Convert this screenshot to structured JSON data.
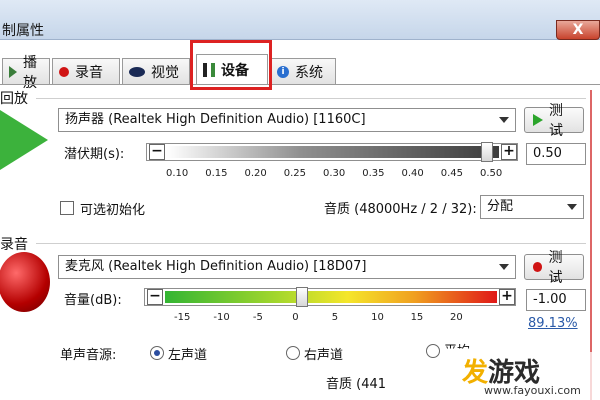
{
  "window": {
    "title": "制属性",
    "close_glyph": "X"
  },
  "tabs": [
    {
      "label": "播放",
      "icon": "speaker-icon"
    },
    {
      "label": "录音",
      "icon": "record-dot-icon"
    },
    {
      "label": "视觉",
      "icon": "eye-icon"
    },
    {
      "label": "设备",
      "icon": "device-icon",
      "active": true
    },
    {
      "label": "系统",
      "icon": "info-icon"
    }
  ],
  "playback": {
    "section_label": "回放",
    "device": "扬声器 (Realtek High Definition Audio) [1160C]",
    "test_button": "测试",
    "latency_label": "潜伏期(s):",
    "latency_ticks": [
      "0.10",
      "0.15",
      "0.20",
      "0.25",
      "0.30",
      "0.35",
      "0.40",
      "0.45",
      "0.50"
    ],
    "latency_value": "0.50",
    "latency_fraction": 0.98,
    "optional_init_label": "可选初始化",
    "quality_label": "音质 (48000Hz / 2 / 32):",
    "quality_select": "分配"
  },
  "recording": {
    "section_label": "录音",
    "device": "麦克风 (Realtek High Definition Audio) [18D07]",
    "test_button": "测试",
    "volume_label": "音量(dB):",
    "volume_ticks": [
      "-15",
      "-10",
      "-5",
      "0",
      "5",
      "10",
      "15",
      "20"
    ],
    "volume_value": "-1.00",
    "volume_percent": "89.13%",
    "volume_fraction": 0.41,
    "mono_source_label": "单声音源:",
    "options": {
      "left": "左声道",
      "right": "右声道",
      "avg": "平均"
    },
    "quality_label": "音质 (441"
  },
  "colors": {
    "accent_red": "#d22222",
    "play_green": "#3cb23c",
    "mic_red": "#c00000"
  },
  "watermark": {
    "main": "发游戏",
    "sub": "www.fayouxi.com"
  }
}
